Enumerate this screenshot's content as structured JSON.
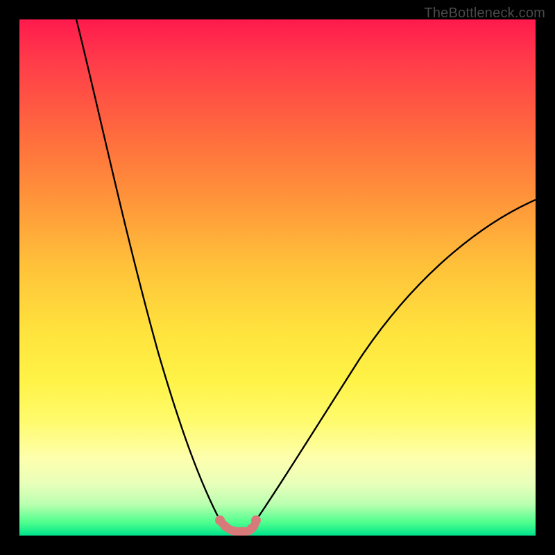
{
  "watermark": "TheBottleneck.com",
  "colors": {
    "frame": "#000000",
    "curve": "#000000",
    "bottom_band": "#d97a7a",
    "bottom_band_dot": "#d97a7a"
  },
  "chart_data": {
    "type": "line",
    "title": "",
    "xlabel": "",
    "ylabel": "",
    "xlim": [
      0,
      100
    ],
    "ylim": [
      0,
      100
    ],
    "grid": false,
    "legend": false,
    "series": [
      {
        "name": "left-curve",
        "x": [
          11,
          14,
          18,
          22,
          26,
          30,
          33,
          35,
          37,
          38.8
        ],
        "values": [
          100,
          82,
          62,
          45,
          31,
          19,
          11,
          6.5,
          3.8,
          2.6
        ]
      },
      {
        "name": "right-curve",
        "x": [
          45.8,
          48,
          51,
          55,
          60,
          66,
          73,
          81,
          90,
          100
        ],
        "values": [
          2.6,
          4.2,
          7.5,
          12.5,
          19,
          27,
          36,
          45.5,
          55,
          65
        ]
      },
      {
        "name": "plateau-band",
        "x": [
          38.8,
          40,
          41,
          42,
          43,
          44,
          45,
          45.8
        ],
        "values": [
          2.6,
          1.4,
          1.0,
          0.9,
          0.9,
          1.0,
          1.5,
          2.6
        ]
      }
    ],
    "annotations": [
      {
        "text": "TheBottleneck.com",
        "position": "top-right"
      }
    ]
  }
}
